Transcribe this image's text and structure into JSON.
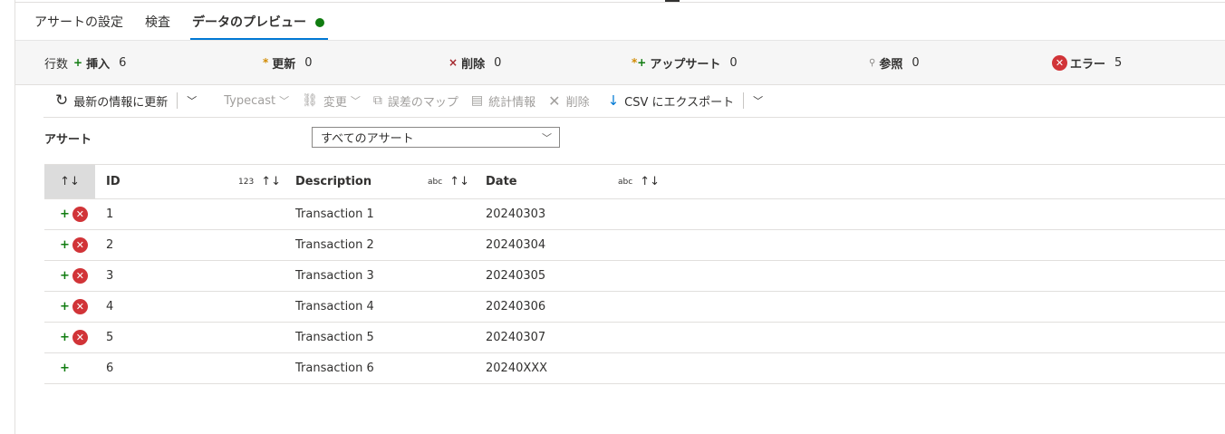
{
  "tabs": [
    {
      "label": "アサートの設定"
    },
    {
      "label": "検査"
    },
    {
      "label": "データのプレビュー"
    }
  ],
  "stats": {
    "rows_label": "行数",
    "insert": {
      "label": "挿入",
      "value": "6"
    },
    "update": {
      "label": "更新",
      "value": "0"
    },
    "delete": {
      "label": "削除",
      "value": "0"
    },
    "upsert": {
      "label": "アップサート",
      "value": "0"
    },
    "lookup": {
      "label": "参照",
      "value": "0"
    },
    "error": {
      "label": "エラー",
      "value": "5"
    }
  },
  "toolbar": {
    "refresh": "最新の情報に更新",
    "typecast": "Typecast",
    "modify": "変更",
    "error_map": "誤差のマップ",
    "statistics": "統計情報",
    "remove": "削除",
    "export": "CSV にエクスポート"
  },
  "filter": {
    "label": "アサート",
    "selected": "すべてのアサート"
  },
  "table": {
    "columns": [
      {
        "name": "ID",
        "type": "123"
      },
      {
        "name": "Description",
        "type": "abc"
      },
      {
        "name": "Date",
        "type": "abc"
      }
    ],
    "rows": [
      {
        "id": "1",
        "description": "Transaction 1",
        "date": "20240303",
        "error": true
      },
      {
        "id": "2",
        "description": "Transaction 2",
        "date": "20240304",
        "error": true
      },
      {
        "id": "3",
        "description": "Transaction 3",
        "date": "20240305",
        "error": true
      },
      {
        "id": "4",
        "description": "Transaction 4",
        "date": "20240306",
        "error": true
      },
      {
        "id": "5",
        "description": "Transaction 5",
        "date": "20240307",
        "error": true
      },
      {
        "id": "6",
        "description": "Transaction 6",
        "date": "20240XXX",
        "error": false
      }
    ]
  },
  "colors": {
    "accent": "#0078d4",
    "success": "#107c10",
    "error": "#d13438",
    "update": "#d18b00"
  }
}
